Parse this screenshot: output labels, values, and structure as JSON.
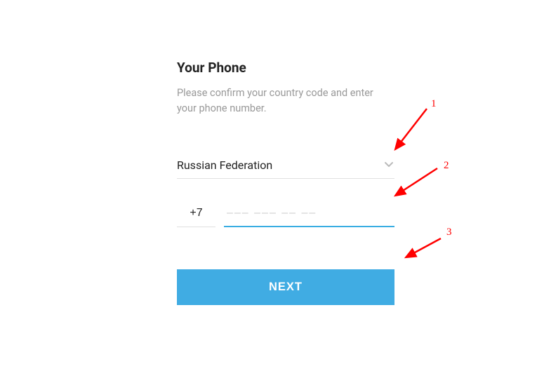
{
  "title": "Your Phone",
  "subtitle": "Please confirm your country code and enter your phone number.",
  "country": {
    "selected": "Russian Federation"
  },
  "phone": {
    "code": "+7",
    "value": "",
    "placeholder": "––– ––– –– ––"
  },
  "next_label": "NEXT",
  "annotations": {
    "a1": "1",
    "a2": "2",
    "a3": "3"
  }
}
